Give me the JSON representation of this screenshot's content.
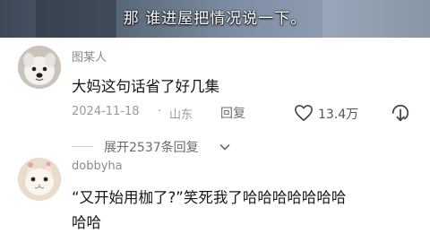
{
  "video": {
    "subtitle": "那  谁进屋把情况说一下。"
  },
  "comments": [
    {
      "username": "图某人",
      "text_lines": [
        "大妈这句话省了好几集"
      ],
      "date": "2024-11-18",
      "separator": "·",
      "location": "山东",
      "reply_label": "回复",
      "like_count": "13.4万"
    },
    {
      "username": "dobbyha",
      "text_lines": [
        "“又开始用枷了?”笑死我了哈哈哈哈哈哈哈",
        "哈哈"
      ]
    }
  ],
  "expand_replies": "展开2537条回复",
  "icons": [
    "heart-outline-icon",
    "dislike-icon",
    "chevron-down-icon"
  ]
}
